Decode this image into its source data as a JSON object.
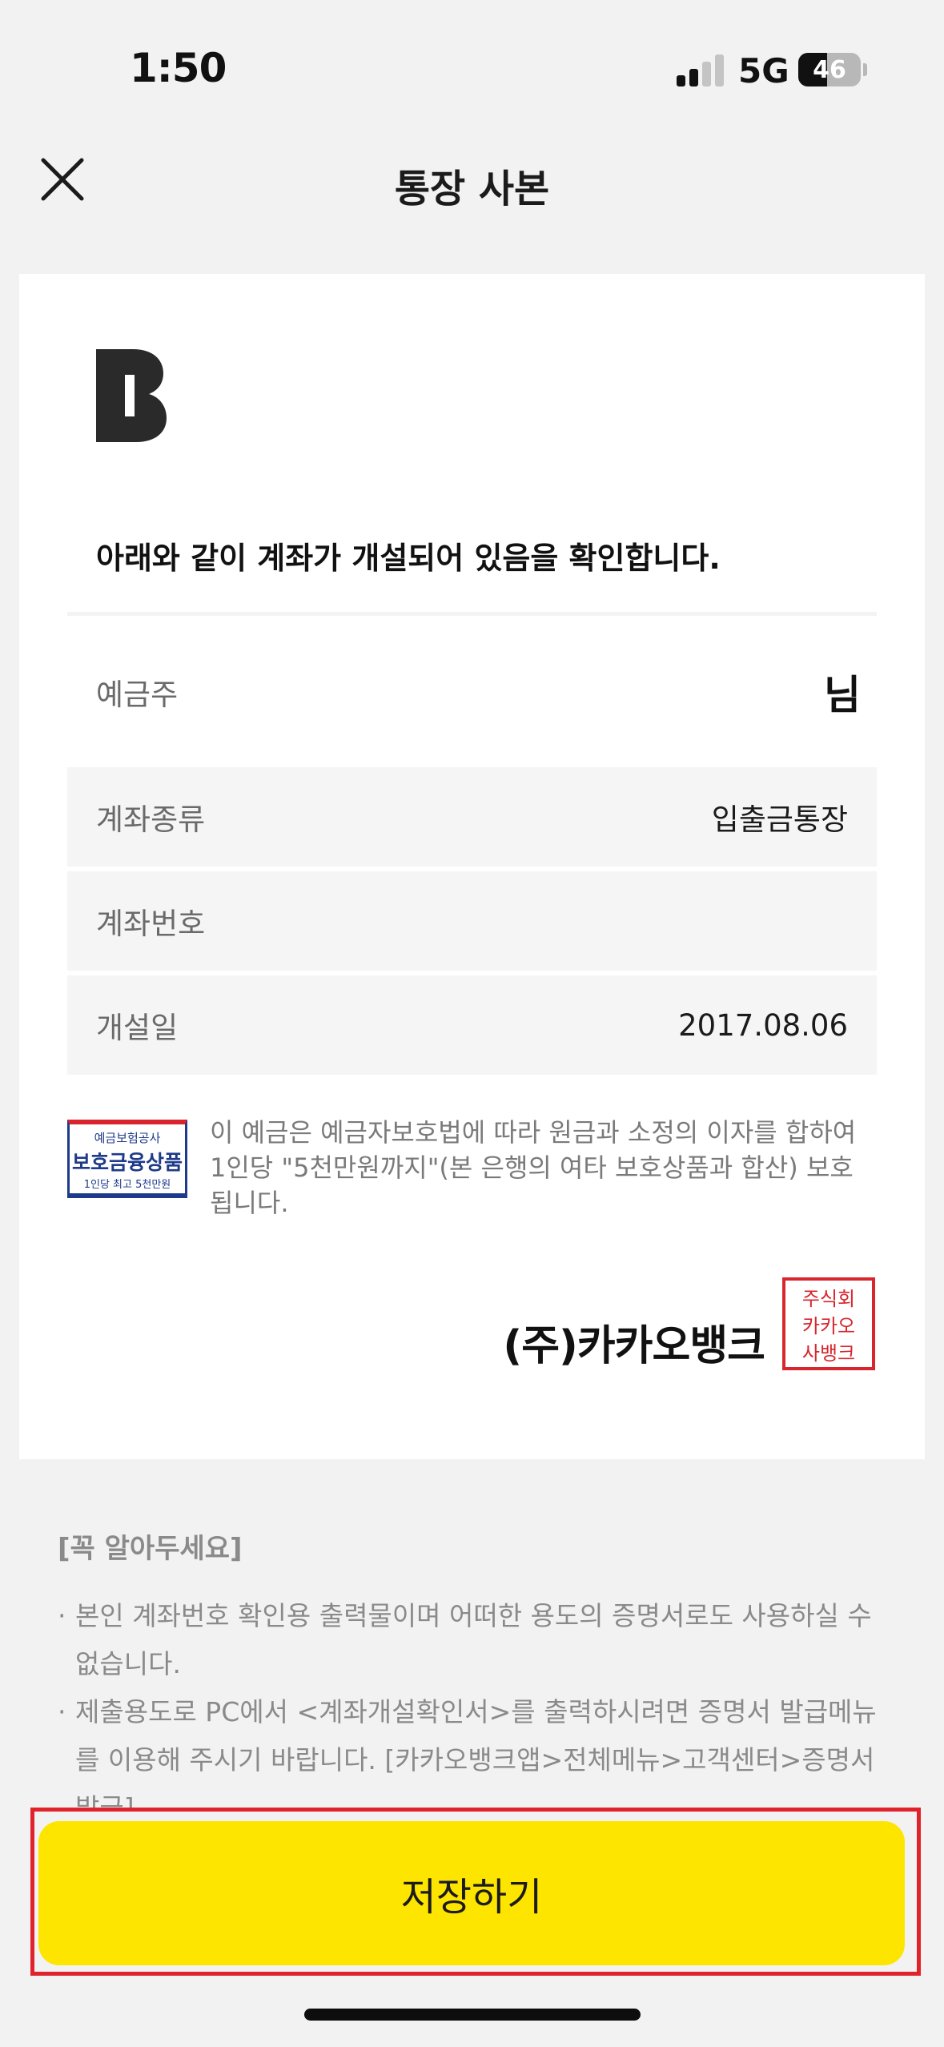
{
  "status_bar": {
    "time": "1:50",
    "network": "5G",
    "battery": "46",
    "battery_level": 0.46
  },
  "header": {
    "title": "통장 사본",
    "close_icon": "close-icon"
  },
  "certificate": {
    "logo_icon": "kakaobank-b-logo",
    "headline": "아래와 같이 계좌가 개설되어 있음을 확인합니다.",
    "rows": [
      {
        "label": "예금주",
        "value": "님"
      },
      {
        "label": "계좌종류",
        "value": "입출금통장"
      },
      {
        "label": "계좌번호",
        "value": ""
      },
      {
        "label": "개설일",
        "value": "2017.08.06"
      }
    ],
    "badge": {
      "top": "예금보험공사",
      "main": "보호금융상품",
      "bottom": "1인당 최고 5천만원"
    },
    "protection_text": "이 예금은 예금자보호법에 따라 원금과 소정의 이자를 합하여 1인당 \"5천만원까지\"(본 은행의 여타 보호상품과 합산) 보호됩니다.",
    "company": "(주)카카오뱅크",
    "seal_icon": "company-seal-stamp",
    "seal_text": [
      "주식회",
      "카카오",
      "사뱅크"
    ]
  },
  "notice": {
    "title": "[꼭 알아두세요]",
    "items": [
      "본인 계좌번호 확인용 출력물이며 어떠한 용도의 증명서로도 사용하실 수 없습니다.",
      "제출용도로 PC에서 <계좌개설확인서>를 출력하시려면 증명서 발급메뉴를 이용해 주시기 바랍니다. [카카오뱅크앱>전체메뉴>고객센터>증명서 발급]"
    ]
  },
  "actions": {
    "save_label": "저장하기"
  },
  "colors": {
    "accent": "#fee500",
    "highlight_border": "#e0222c",
    "background": "#f2f2f2"
  }
}
